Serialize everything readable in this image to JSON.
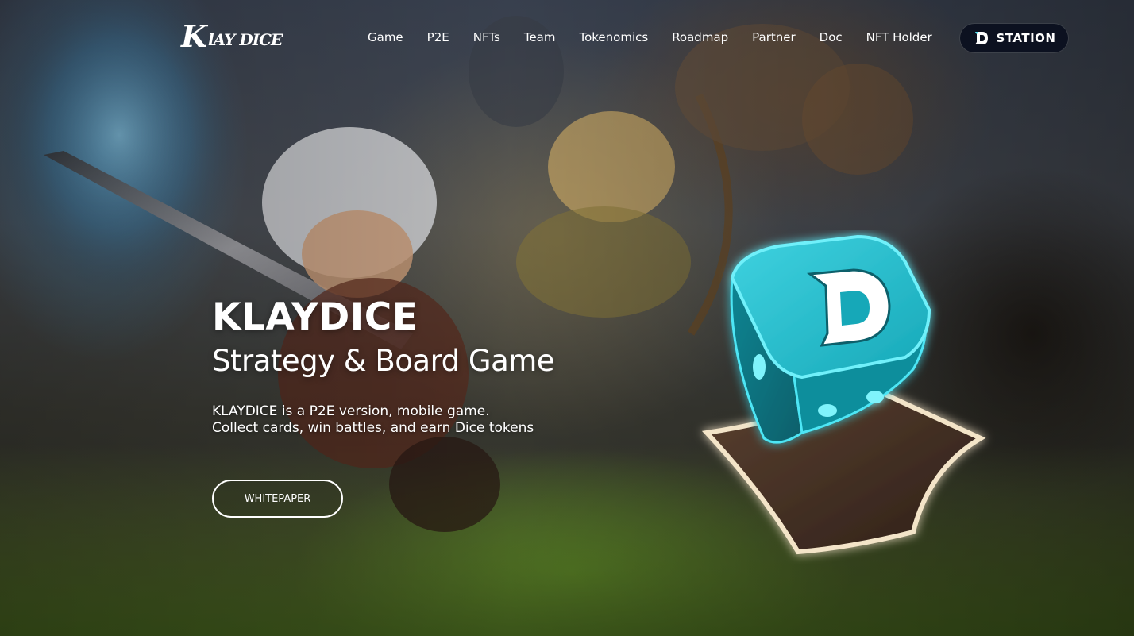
{
  "brand": {
    "logo_k": "K",
    "logo_rest": "lAY DICE"
  },
  "nav": {
    "items": [
      {
        "label": "Game"
      },
      {
        "label": "P2E"
      },
      {
        "label": "NFTs"
      },
      {
        "label": "Team"
      },
      {
        "label": "Tokenomics"
      },
      {
        "label": "Roadmap"
      },
      {
        "label": "Partner"
      },
      {
        "label": "Doc"
      },
      {
        "label": "NFT Holder"
      }
    ],
    "station_label": "STATION",
    "station_icon": "d-logo-icon"
  },
  "hero": {
    "title": "KLAYDICE",
    "subtitle": "Strategy & Board Game",
    "description_line1": "KLAYDICE is a P2E version, mobile game.",
    "description_line2": "Collect cards, win battles, and earn Dice tokens",
    "button_label": "WHITEPAPER"
  },
  "colors": {
    "dice_cyan": "#1fb8c8",
    "dice_glow": "#4ee6f5",
    "station_bg": "#0c1120",
    "text": "#ffffff"
  }
}
